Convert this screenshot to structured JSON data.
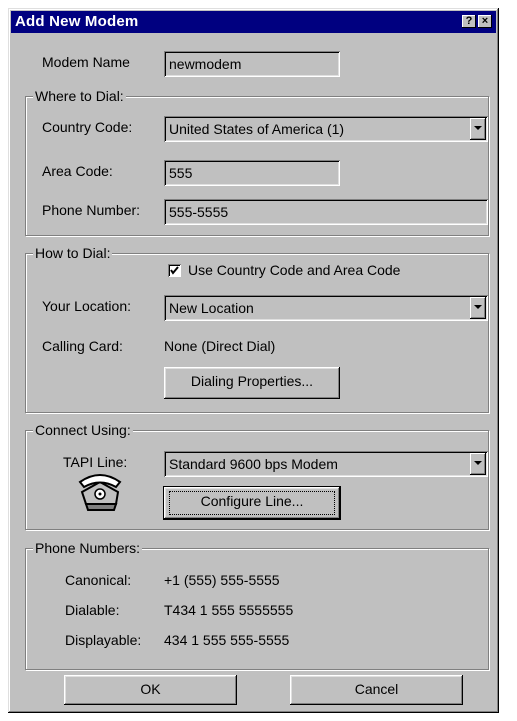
{
  "window": {
    "title": "Add New Modem",
    "help_label": "?",
    "close_label": "×"
  },
  "modem_name": {
    "label": "Modem Name",
    "value": "newmodem"
  },
  "where_to_dial": {
    "group_title": "Where to Dial:",
    "country_code_label": "Country Code:",
    "country_code_value": "United States of America (1)",
    "area_code_label": "Area Code:",
    "area_code_value": "555",
    "phone_number_label": "Phone Number:",
    "phone_number_value": "555-5555"
  },
  "how_to_dial": {
    "group_title": "How to Dial:",
    "use_country_area_label": "Use Country Code and Area Code",
    "use_country_area_checked": true,
    "your_location_label": "Your Location:",
    "your_location_value": "New Location",
    "calling_card_label": "Calling Card:",
    "calling_card_value": "None (Direct Dial)",
    "dialing_properties_label": "Dialing Properties..."
  },
  "connect_using": {
    "group_title": "Connect Using:",
    "tapi_line_label": "TAPI Line:",
    "tapi_line_value": "Standard  9600 bps Modem",
    "configure_line_label": "Configure Line...",
    "icon": "telephone-icon"
  },
  "phone_numbers": {
    "group_title": "Phone Numbers:",
    "canonical_label": "Canonical:",
    "canonical_value": "+1 (555) 555-5555",
    "dialable_label": "Dialable:",
    "dialable_value": "T434  1 555 5555555",
    "displayable_label": "Displayable:",
    "displayable_value": "434  1 555 555-5555"
  },
  "footer": {
    "ok_label": "OK",
    "cancel_label": "Cancel"
  },
  "colors": {
    "titlebar": "#000080",
    "face": "#c0c0c0"
  }
}
